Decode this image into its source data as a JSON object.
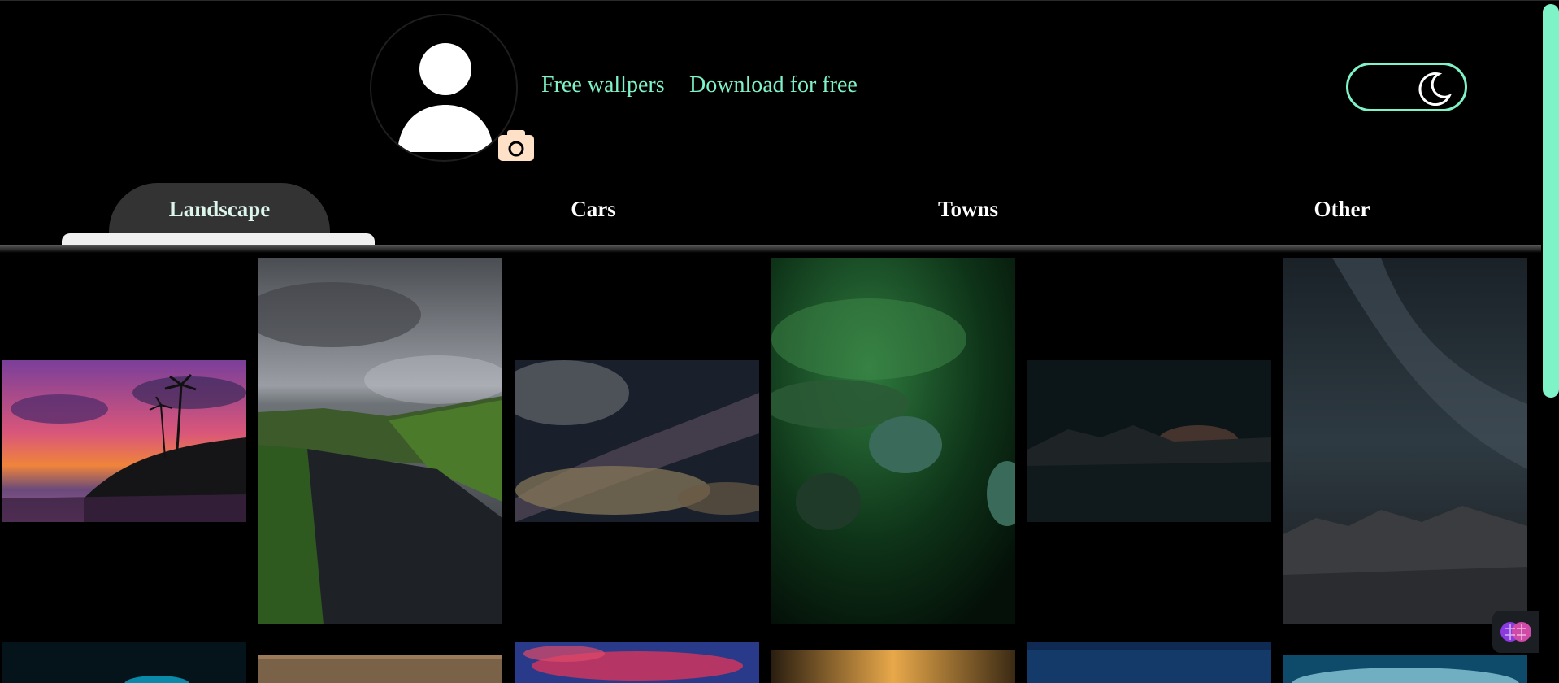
{
  "header": {
    "links": [
      {
        "label": "Free wallpers"
      },
      {
        "label": "Download for free"
      }
    ],
    "theme_toggle": {
      "mode": "dark",
      "icon": "moon-icon"
    },
    "avatar": {
      "icon": "user-silhouette-icon",
      "upload_icon": "camera-icon"
    }
  },
  "tabs": [
    {
      "label": "Landscape",
      "active": true
    },
    {
      "label": "Cars",
      "active": false
    },
    {
      "label": "Towns",
      "active": false
    },
    {
      "label": "Other",
      "active": false
    }
  ],
  "gallery": {
    "images": [
      {
        "subject": "sunset-palms"
      },
      {
        "subject": "river-valley"
      },
      {
        "subject": "milky-way-clouds"
      },
      {
        "subject": "dew-leaf"
      },
      {
        "subject": "night-lake"
      },
      {
        "subject": "starry-rocks"
      },
      {
        "subject": "cyan-glow"
      },
      {
        "subject": "dusk-sky"
      },
      {
        "subject": "pink-clouds"
      },
      {
        "subject": "golden-splash"
      },
      {
        "subject": "blue-stars"
      },
      {
        "subject": "teal-clouds"
      }
    ]
  },
  "widgets": {
    "ai_assistant_icon": "brain-icon"
  },
  "colors": {
    "accent": "#7ff3c8",
    "background": "#000000",
    "active_tab": "#333333",
    "camera": "#ffe1c7"
  }
}
